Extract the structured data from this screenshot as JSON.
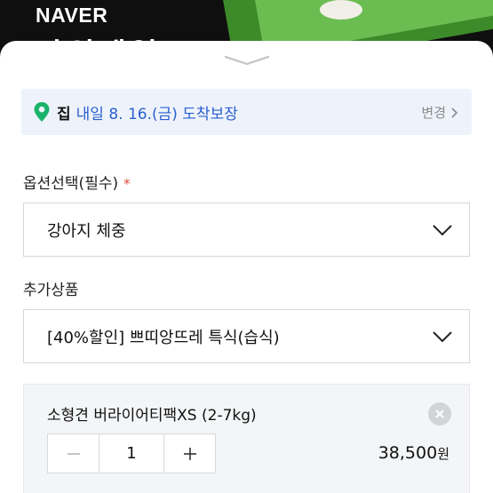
{
  "banner": {
    "logo": "NAVER",
    "headline": "파워세일"
  },
  "delivery": {
    "place": "집",
    "text": "내일 8. 16.(금) 도착보장",
    "change_label": "변경",
    "pin_color": "#1bb36b",
    "text_color": "#2a5fd0"
  },
  "option": {
    "label": "옵션선택(필수)",
    "required_mark": "*",
    "selected": "강아지 체중"
  },
  "addon": {
    "label": "추가상품",
    "selected": "[40%할인] 쁘띠앙뜨레 특식(습식)"
  },
  "item": {
    "name": "소형견 버라이어티팩XS (2-7kg)",
    "quantity": "1",
    "price": "38,500",
    "currency": "원"
  },
  "icons": [
    "location-pin-icon",
    "chevron-right-icon",
    "chevron-down-icon",
    "close-icon",
    "minus-icon",
    "plus-icon"
  ]
}
